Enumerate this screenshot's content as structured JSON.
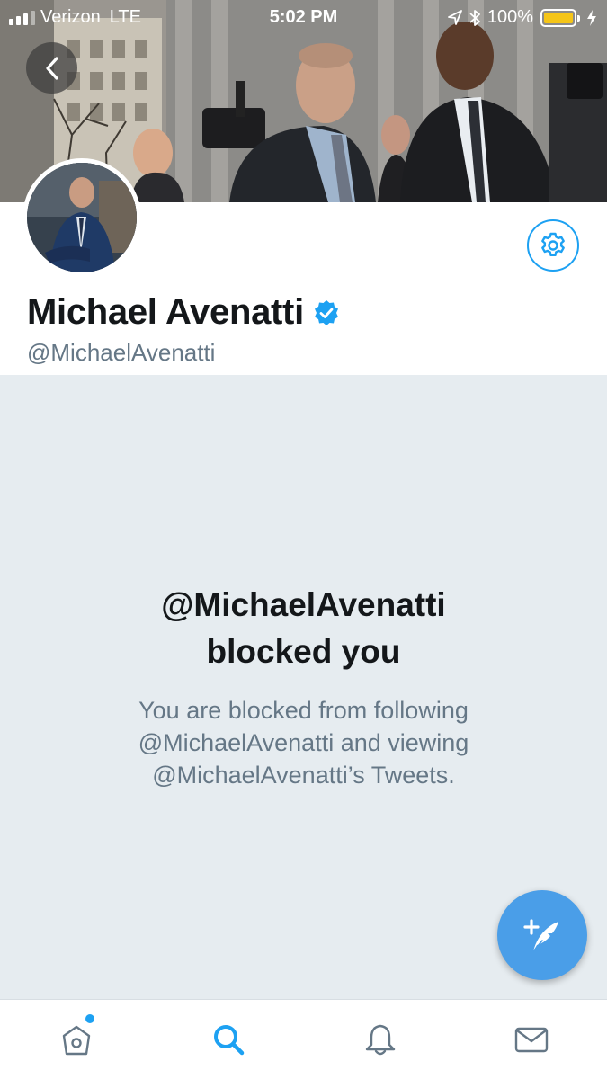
{
  "status_bar": {
    "carrier": "Verizon",
    "network": "LTE",
    "time": "5:02 PM",
    "battery": "100%",
    "icons": [
      "signal-icon",
      "location-icon",
      "bluetooth-icon",
      "battery-icon",
      "charging-icon"
    ]
  },
  "header": {
    "back_icon": "chevron-left-icon",
    "banner": "cover-photo"
  },
  "profile": {
    "display_name": "Michael Avenatti",
    "verified_icon": "verified-badge-icon",
    "handle": "@MichaelAvenatti",
    "settings_icon": "gear-icon"
  },
  "blocked": {
    "title_line1": "@MichaelAvenatti",
    "title_line2": "blocked you",
    "desc_line1": "You are blocked from following",
    "desc_line2": "@MichaelAvenatti and viewing",
    "desc_line3": "@MichaelAvenatti’s Tweets."
  },
  "compose": {
    "icon": "compose-tweet-icon"
  },
  "tab_bar": {
    "tabs": [
      {
        "name": "home",
        "icon": "home-icon",
        "active": false,
        "has_badge": true
      },
      {
        "name": "search",
        "icon": "search-icon",
        "active": true,
        "has_badge": false
      },
      {
        "name": "notifications",
        "icon": "bell-icon",
        "active": false,
        "has_badge": false
      },
      {
        "name": "messages",
        "icon": "mail-icon",
        "active": false,
        "has_badge": false
      }
    ]
  },
  "colors": {
    "accent": "#1da1f2",
    "compose": "#4a9ee8",
    "panel_bg": "#e6ecf0",
    "text_primary": "#14171a",
    "text_secondary": "#657786",
    "battery": "#f5c518"
  }
}
